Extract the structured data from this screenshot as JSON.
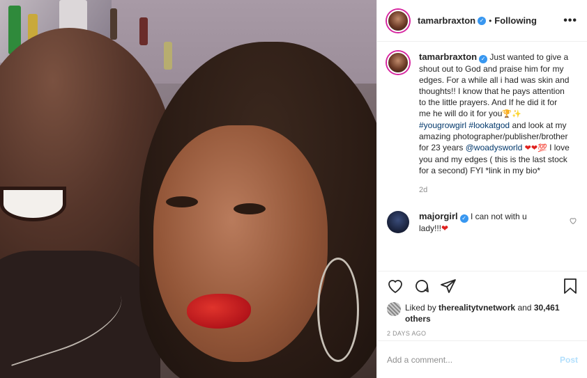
{
  "header": {
    "username": "tamarbraxton",
    "separator": "•",
    "follow_status": "Following",
    "more": "•••"
  },
  "caption": {
    "username": "tamarbraxton",
    "text_1": "Just wanted to give a shout out to God and praise him for my edges. For a while all i had was skin and thoughts!! I know that he pays attention to the little prayers. And If he did it for me he will do it for you",
    "emoji_1": "🏆✨",
    "hashtag_1": "#yougrowgirl",
    "hashtag_2": "#lookatgod",
    "text_2": "and look at my amazing photographer/publisher/brother for 23 years",
    "mention": "@woadysworld",
    "emoji_2": "❤❤💯",
    "text_3": "I love you and my edges ( this is the last stock for a second) FYI *link in my bio*",
    "time": "2d"
  },
  "comment": {
    "username": "majorgirl",
    "text": "I can not with u lady!!!",
    "emoji": "❤"
  },
  "likes": {
    "prefix": "Liked by",
    "user": "therealitytvnetwork",
    "and": "and",
    "others": "30,461 others"
  },
  "posted": "2 DAYS AGO",
  "add_comment": {
    "placeholder": "Add a comment...",
    "post_label": "Post"
  },
  "icons": [
    "heart-icon",
    "comment-icon",
    "share-icon",
    "bookmark-icon",
    "verified-icon",
    "more-icon"
  ],
  "colors": {
    "link": "#00376b",
    "verified": "#3897f0",
    "muted": "#8e8e8e",
    "post_disabled": "#b2dffc"
  }
}
